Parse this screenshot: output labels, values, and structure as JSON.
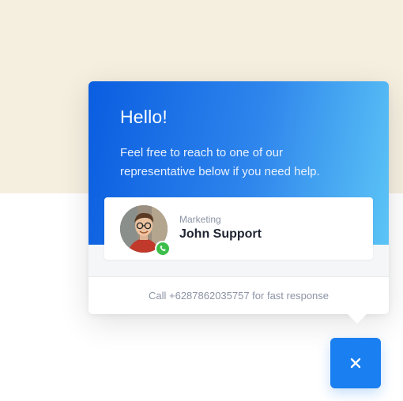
{
  "colors": {
    "background_top": "#f5efe0",
    "header_gradient_start": "#0a5de0",
    "header_gradient_end": "#5cc4f6",
    "accent": "#1a7ff0",
    "status_online": "#3cbf4a"
  },
  "widget": {
    "greeting": "Hello!",
    "intro": "Feel free to reach to one of our representative below if you need help.",
    "agent": {
      "department": "Marketing",
      "name": "John Support",
      "avatar_icon": "user-photo",
      "status_icon": "whatsapp-phone-icon"
    },
    "footer_text": "Call +6287862035757 for fast response"
  },
  "toggle_button": {
    "icon": "close-icon"
  }
}
